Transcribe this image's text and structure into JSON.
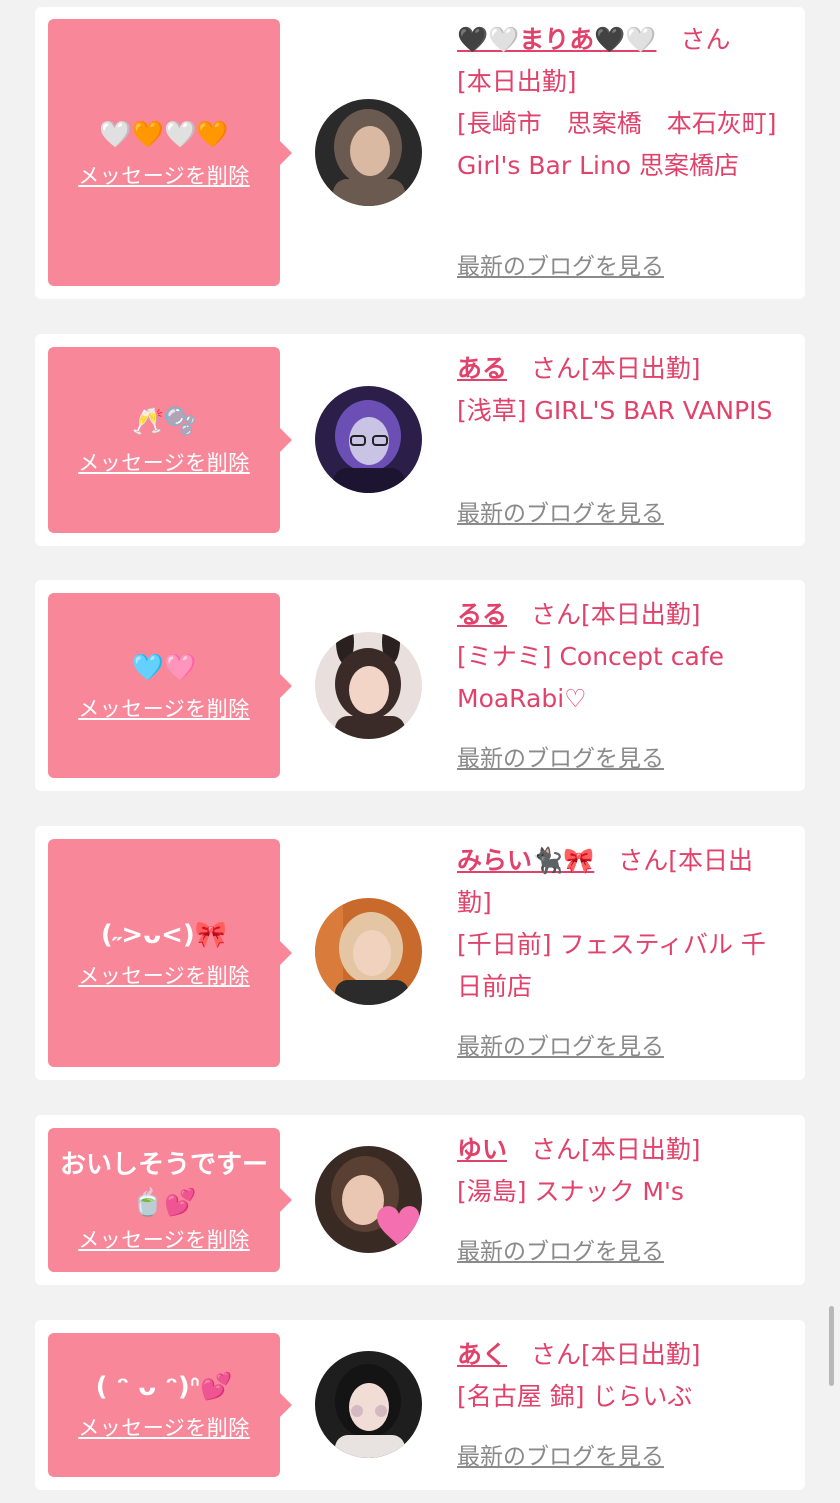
{
  "items": [
    {
      "message": "🤍🧡🤍🧡",
      "delete_label": "メッセージを削除",
      "name": "🖤🤍まりあ🖤🤍",
      "san": "さん",
      "status": "[本日出勤]",
      "shop": "[長崎市　思案橋　本石灰町] Girl's Bar Lino 思案橋店",
      "blog_label": "最新のブログを見る",
      "avatar_colors": [
        "#2a2a2a",
        "#d9b9a2",
        "#6b5a4f"
      ]
    },
    {
      "message": "🥂🫧",
      "delete_label": "メッセージを削除",
      "name": "ある",
      "san": "さん",
      "status": "[本日出勤]",
      "shop": "[浅草] GIRL'S BAR VANPIS",
      "blog_label": "最新のブログを見る",
      "avatar_colors": [
        "#2b1f4a",
        "#c9c3e6",
        "#6c4fb5"
      ]
    },
    {
      "message": "🩵🩷",
      "delete_label": "メッセージを削除",
      "name": "るる",
      "san": "さん",
      "status": "[本日出勤]",
      "shop": "[ミナミ] Concept cafe MoaRabi♡",
      "blog_label": "最新のブログを見る",
      "avatar_colors": [
        "#e9dfdc",
        "#f3d5c8",
        "#3b2b28"
      ]
    },
    {
      "message": "(˶>ᴗ<)🎀",
      "delete_label": "メッセージを削除",
      "name": "みらい🐈‍⬛🎀",
      "san": "さん",
      "status": "[本日出勤]",
      "shop": "[千日前] フェスティバル 千日前店",
      "blog_label": "最新のブログを見る",
      "avatar_colors": [
        "#c86a2c",
        "#f0d2bf",
        "#2b2b2b"
      ]
    },
    {
      "message": "おいしそうですー\n🍵💕",
      "delete_label": "メッセージを削除",
      "name": "ゆい",
      "san": "さん",
      "status": "[本日出勤]",
      "shop": "[湯島] スナック M's",
      "blog_label": "最新のブログを見る",
      "avatar_colors": [
        "#3a2a24",
        "#e9c7b2",
        "#f46fb0"
      ]
    },
    {
      "message": "( ᵔ ᴗ ᵔ)ᐢ💕",
      "delete_label": "メッセージを削除",
      "name": "あく",
      "san": "さん",
      "status": "[本日出勤]",
      "shop": "[名古屋 錦] じらいぶ",
      "blog_label": "最新のブログを見る",
      "avatar_colors": [
        "#1e1e1e",
        "#f1ddd6",
        "#c9a9b9"
      ]
    }
  ]
}
